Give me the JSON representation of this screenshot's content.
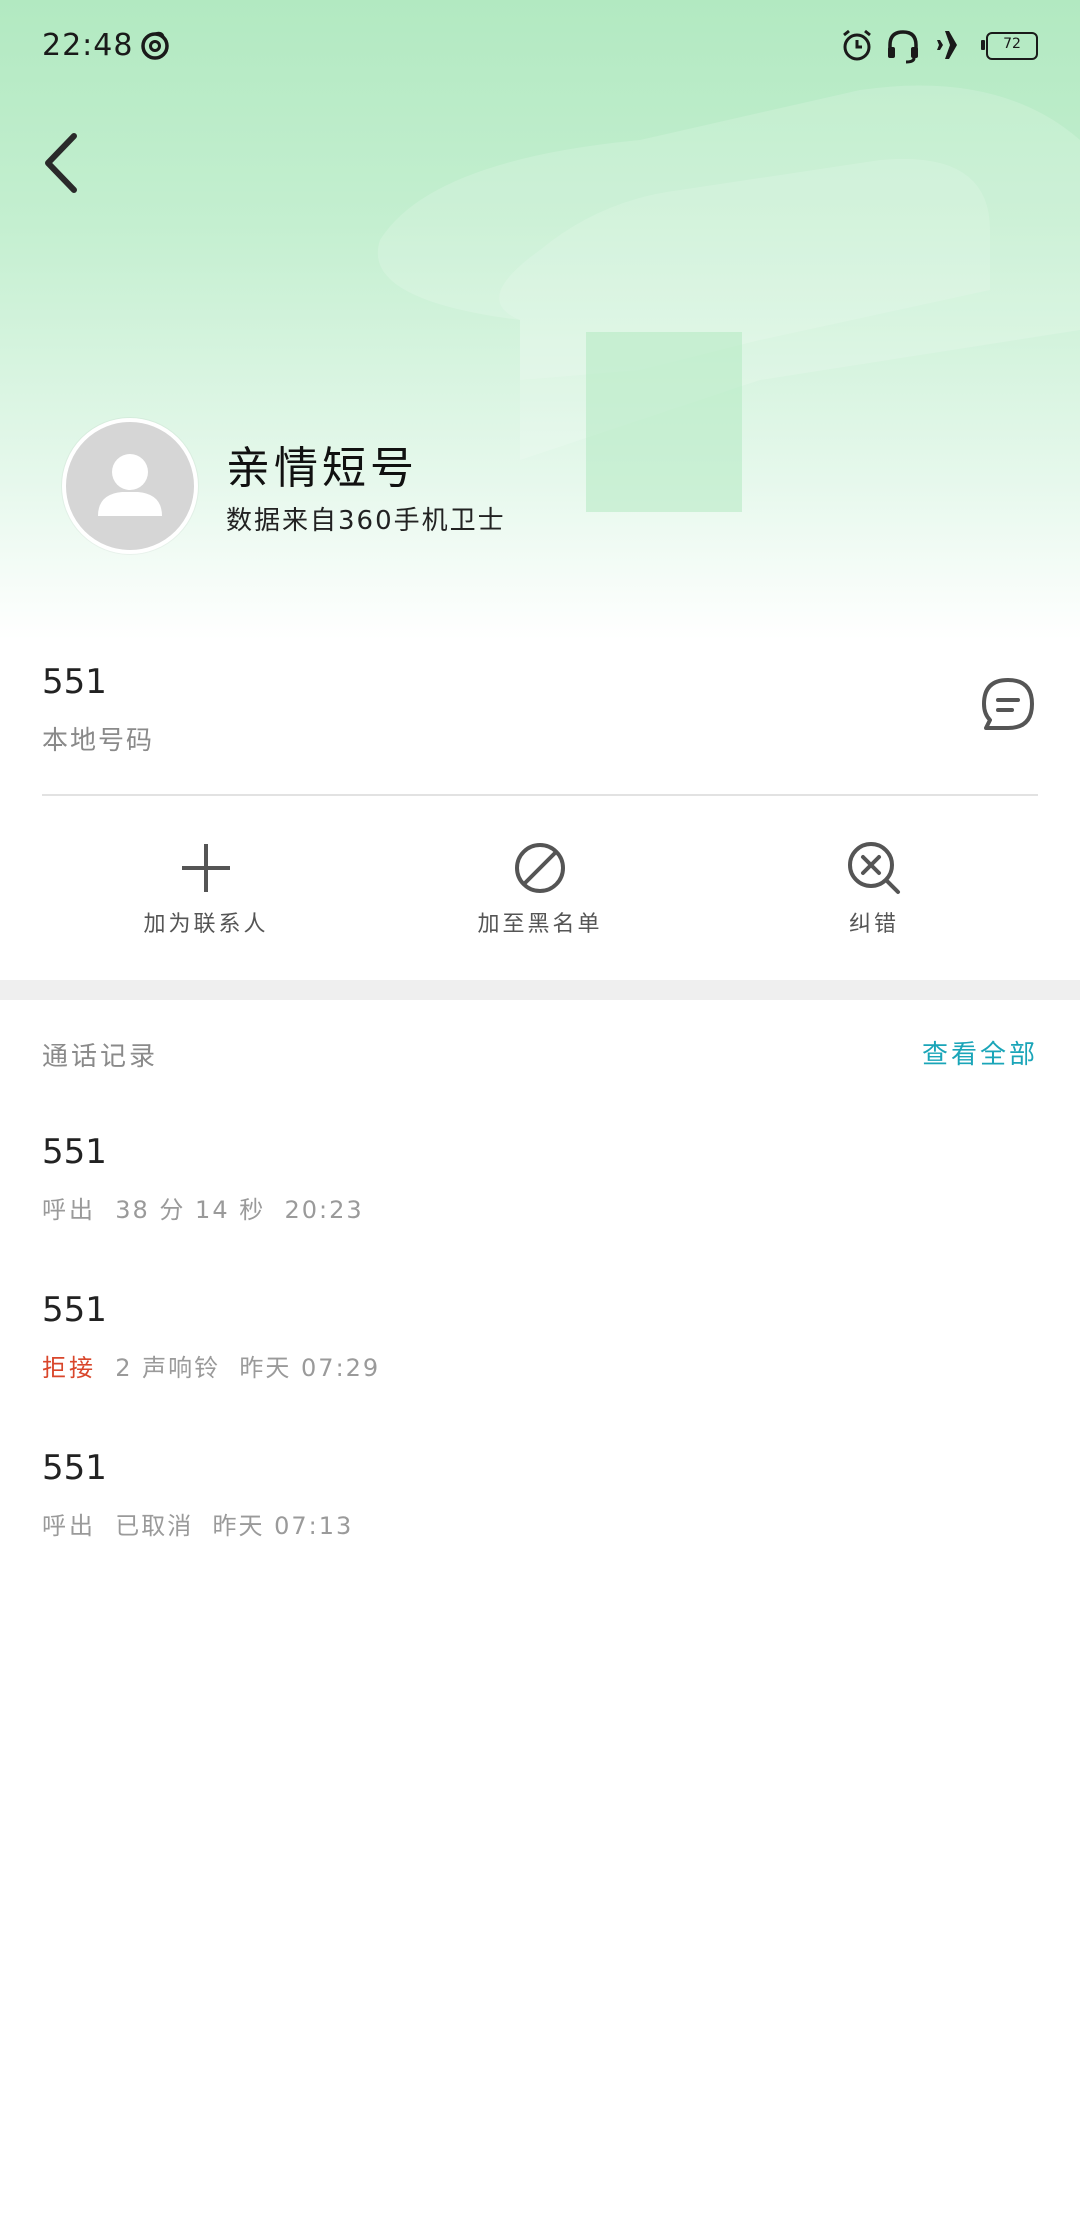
{
  "status_bar": {
    "time": "22:48",
    "battery": "72",
    "icons": [
      "netease-music-icon",
      "alarm-icon",
      "headset-icon",
      "airplane-icon",
      "battery-icon"
    ]
  },
  "contact": {
    "name": "亲情短号",
    "source": "数据来自360手机卫士",
    "number": "551",
    "number_label": "本地号码"
  },
  "actions": [
    {
      "label": "加为联系人",
      "icon": "plus-icon"
    },
    {
      "label": "加至黑名单",
      "icon": "block-icon"
    },
    {
      "label": "纠错",
      "icon": "search-cancel-icon"
    }
  ],
  "call_log": {
    "title": "通话记录",
    "view_all": "查看全部",
    "entries": [
      {
        "number": "551",
        "type": "呼出",
        "detail": "  38 分 14 秒  20:23",
        "rejected": false
      },
      {
        "number": "551",
        "type": "拒接",
        "detail": "  2 声响铃  昨天 07:29",
        "rejected": true
      },
      {
        "number": "551",
        "type": "呼出",
        "detail": "  已取消  昨天 07:13",
        "rejected": false
      }
    ]
  },
  "colors": {
    "header_green": "#b2e9c1",
    "accent_teal": "#1aa5b8",
    "rejected_red": "#d9462b"
  }
}
